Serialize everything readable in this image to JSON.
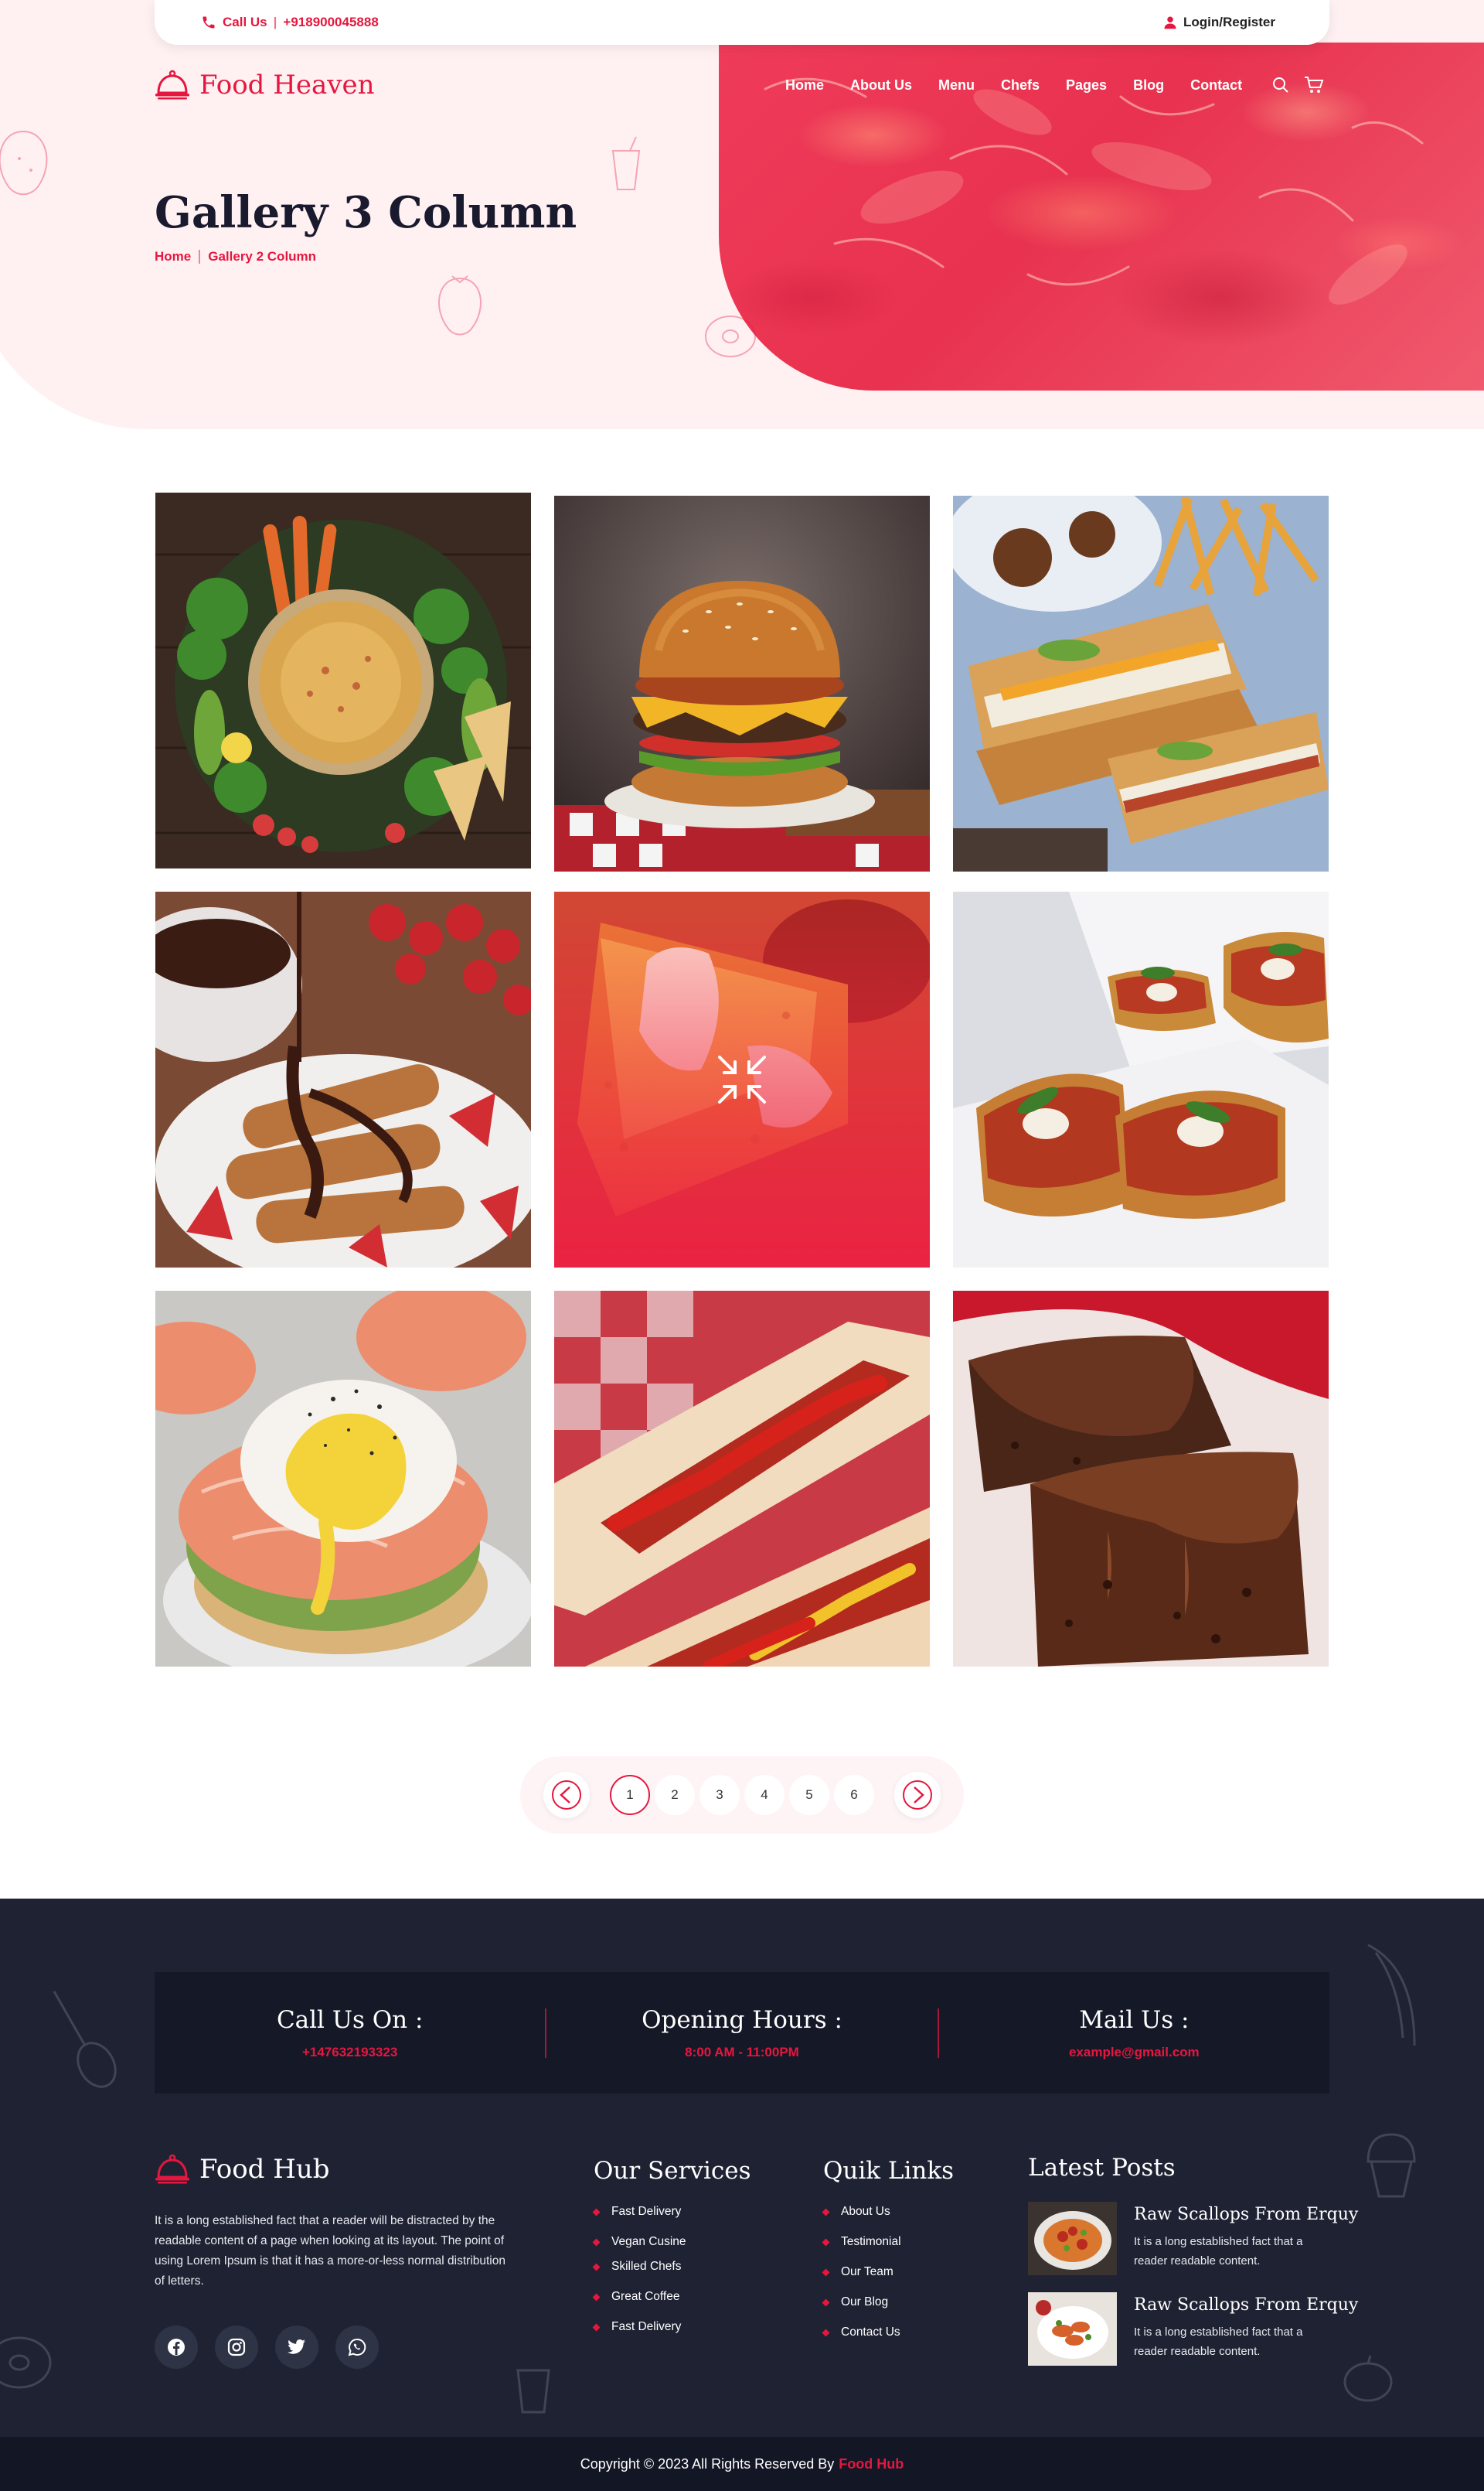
{
  "topbar": {
    "call_label": "Call Us",
    "phone": "+918900045888",
    "login_label": "Login/Register"
  },
  "brand": {
    "name": "Food Heaven",
    "accent": "#e5173f"
  },
  "nav": {
    "items": [
      "Home",
      "About Us",
      "Menu",
      "Chefs",
      "Pages",
      "Blog",
      "Contact"
    ],
    "icons": [
      "search-icon",
      "cart-icon"
    ]
  },
  "hero": {
    "title": "Gallery 3 Column",
    "breadcrumb": [
      "Home",
      "Gallery 2 Column"
    ]
  },
  "gallery": {
    "items": [
      "Hummus platter with vegetables",
      "Cheeseburger",
      "Grilled sandwich with fries",
      "Crepes with chocolate and strawberries",
      "Fried mozzarella stick",
      "Bruschetta toasts",
      "Poached egg with salmon",
      "Hot dogs with ketchup and mustard",
      "Chocolate brownie"
    ],
    "hover_icon": "compress-icon"
  },
  "pagination": {
    "pages": [
      "1",
      "2",
      "3",
      "4",
      "5",
      "6"
    ],
    "active": "1"
  },
  "contact_strip": {
    "call_title": "Call Us On :",
    "call_value": "+147632193323",
    "hours_title": "Opening Hours :",
    "hours_value": "8:00 AM - 11:00PM",
    "mail_title": "Mail Us :",
    "mail_value": "example@gmail.com"
  },
  "footer": {
    "brand": "Food Hub",
    "about": "It is a long established fact that a reader will be distracted by the readable content of a page when looking at its layout. The point of using Lorem Ipsum is that it has a more-or-less normal distribution of letters.",
    "socials": [
      "facebook-icon",
      "instagram-icon",
      "twitter-icon",
      "whatsapp-icon"
    ],
    "services_title": "Our Services",
    "services": [
      "Fast Delivery",
      "Vegan Cusine",
      "Skilled Chefs",
      "Great Coffee",
      "Fast Delivery"
    ],
    "links_title": "Quik Links",
    "links": [
      "About Us",
      "Testimonial",
      "Our Team",
      "Our Blog",
      "Contact Us"
    ],
    "posts_title": "Latest Posts",
    "posts": [
      {
        "title": "Raw Scallops From Erquy",
        "text": "It is a long established fact that a reader readable content."
      },
      {
        "title": "Raw Scallops From Erquy",
        "text": "It is a long established fact that a reader readable content."
      }
    ],
    "copyright": "Copyright © 2023 All Rights Reserved By",
    "copyright_brand": "Food Hub"
  }
}
